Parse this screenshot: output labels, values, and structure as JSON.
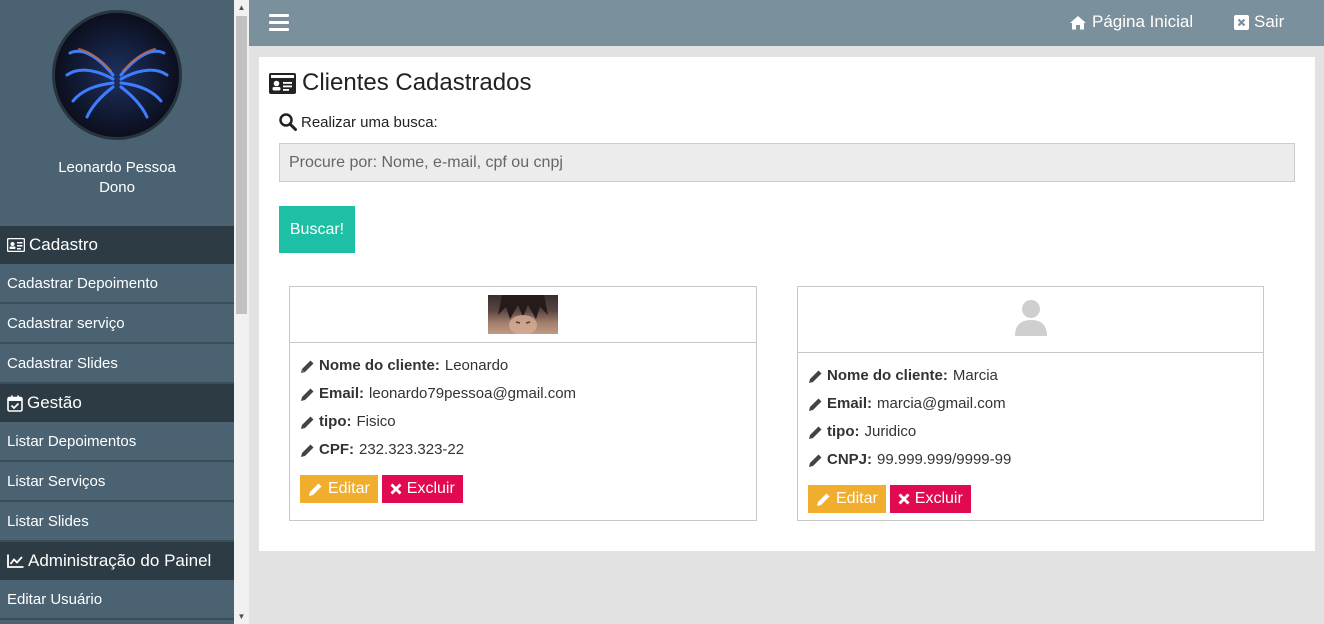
{
  "sidebar": {
    "user_name": "Leonardo Pessoa",
    "user_role": "Dono",
    "sections": [
      {
        "title": "Cadastro",
        "icon": "id-card-icon",
        "items": [
          "Cadastrar Depoimento",
          "Cadastrar serviço",
          "Cadastrar Slides"
        ]
      },
      {
        "title": "Gestão",
        "icon": "calendar-check-icon",
        "items": [
          "Listar Depoimentos",
          "Listar Serviços",
          "Listar Slides"
        ]
      },
      {
        "title": "Administração do Painel",
        "icon": "line-chart-icon",
        "items": [
          "Editar Usuário"
        ]
      }
    ]
  },
  "header": {
    "home_label": "Página Inicial",
    "logout_label": "Sair"
  },
  "main": {
    "title": "Clientes Cadastrados",
    "search_label": "Realizar uma busca:",
    "search_placeholder": "Procure por: Nome, e-mail, cpf ou cnpj",
    "search_button": "Buscar!",
    "clients": [
      {
        "name_label": "Nome do cliente:",
        "name": "Leonardo",
        "email_label": "Email:",
        "email": "leonardo79pessoa@gmail.com",
        "type_label": "tipo:",
        "type": "Fisico",
        "doc_label": "CPF:",
        "doc": "232.323.323-22",
        "edit_label": "Editar",
        "delete_label": "Excluir"
      },
      {
        "name_label": "Nome do cliente:",
        "name": "Marcia",
        "email_label": "Email:",
        "email": "marcia@gmail.com",
        "type_label": "tipo:",
        "type": "Juridico",
        "doc_label": "CNPJ:",
        "doc": "99.999.999/9999-99",
        "edit_label": "Editar",
        "delete_label": "Excluir"
      }
    ]
  },
  "colors": {
    "sidebar_bg": "#4a6271",
    "section_bg": "#2d3b44",
    "topbar_bg": "#7a909c",
    "search_button": "#1dc0a5",
    "edit_button": "#f0ad2e",
    "delete_button": "#e1094f"
  }
}
